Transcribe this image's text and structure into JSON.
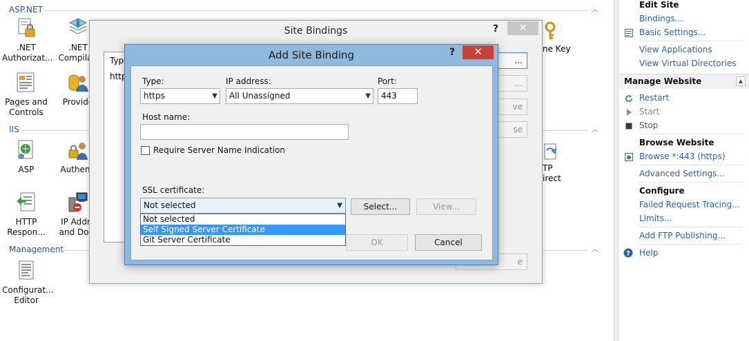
{
  "groups": {
    "aspnet": "ASP.NET",
    "iis": "IIS",
    "management": "Management"
  },
  "features": {
    "net_authorization": ".NET\nAuthorizat...",
    "net_compilation": ".NET\nCompilati",
    "pages_controls": "Pages and\nControls",
    "providers": "Provide",
    "asp": "ASP",
    "authentication": "Authenti",
    "http_response": "HTTP\nRespon...",
    "ip_address": "IP Addre\nand Dom",
    "config_editor": "Configurat...\nEditor",
    "machine_key": "ne Key",
    "http_redirect": "TP\nirect"
  },
  "site_bindings": {
    "title": "Site Bindings",
    "help": "?",
    "close": "✕",
    "type_header": "Type",
    "row_type": "http",
    "buttons": [
      "...",
      "...",
      "ve",
      "se",
      "e"
    ]
  },
  "add_binding": {
    "title": "Add Site Binding",
    "help": "?",
    "close": "✕",
    "type_label": "Type:",
    "type_value": "https",
    "ip_label": "IP address:",
    "ip_value": "All Unassigned",
    "port_label": "Port:",
    "port_value": "443",
    "host_label": "Host name:",
    "host_value": "",
    "sni_label": "Require Server Name Indication",
    "sni_checked": false,
    "ssl_label": "SSL certificate:",
    "ssl_value": "Not selected",
    "ssl_options": [
      "Not selected",
      "Self Signed Server Certificate",
      "Git Server Certificate"
    ],
    "ssl_highlighted": 1,
    "select_btn": "Select...",
    "view_btn": "View...",
    "ok_btn": "OK",
    "cancel_btn": "Cancel"
  },
  "actions": {
    "edit_site_header": "Edit Site",
    "bindings": "Bindings...",
    "basic_settings": "Basic Settings...",
    "view_applications": "View Applications",
    "view_virtual_dirs": "View Virtual Directories",
    "manage_website": "Manage Website",
    "restart": "Restart",
    "start": "Start",
    "stop": "Stop",
    "browse_website": "Browse Website",
    "browse_443": "Browse *:443 (https)",
    "advanced_settings": "Advanced Settings...",
    "configure": "Configure",
    "failed_request_tracing": "Failed Request Tracing...",
    "limits": "Limits...",
    "add_ftp": "Add FTP Publishing...",
    "help": "Help"
  },
  "colors": {
    "link": "#2a63a8",
    "group_title": "#1e5a9a",
    "dialog_frame": "#8fb9dd",
    "close_red": "#c7403a",
    "highlight": "#3399ff"
  }
}
